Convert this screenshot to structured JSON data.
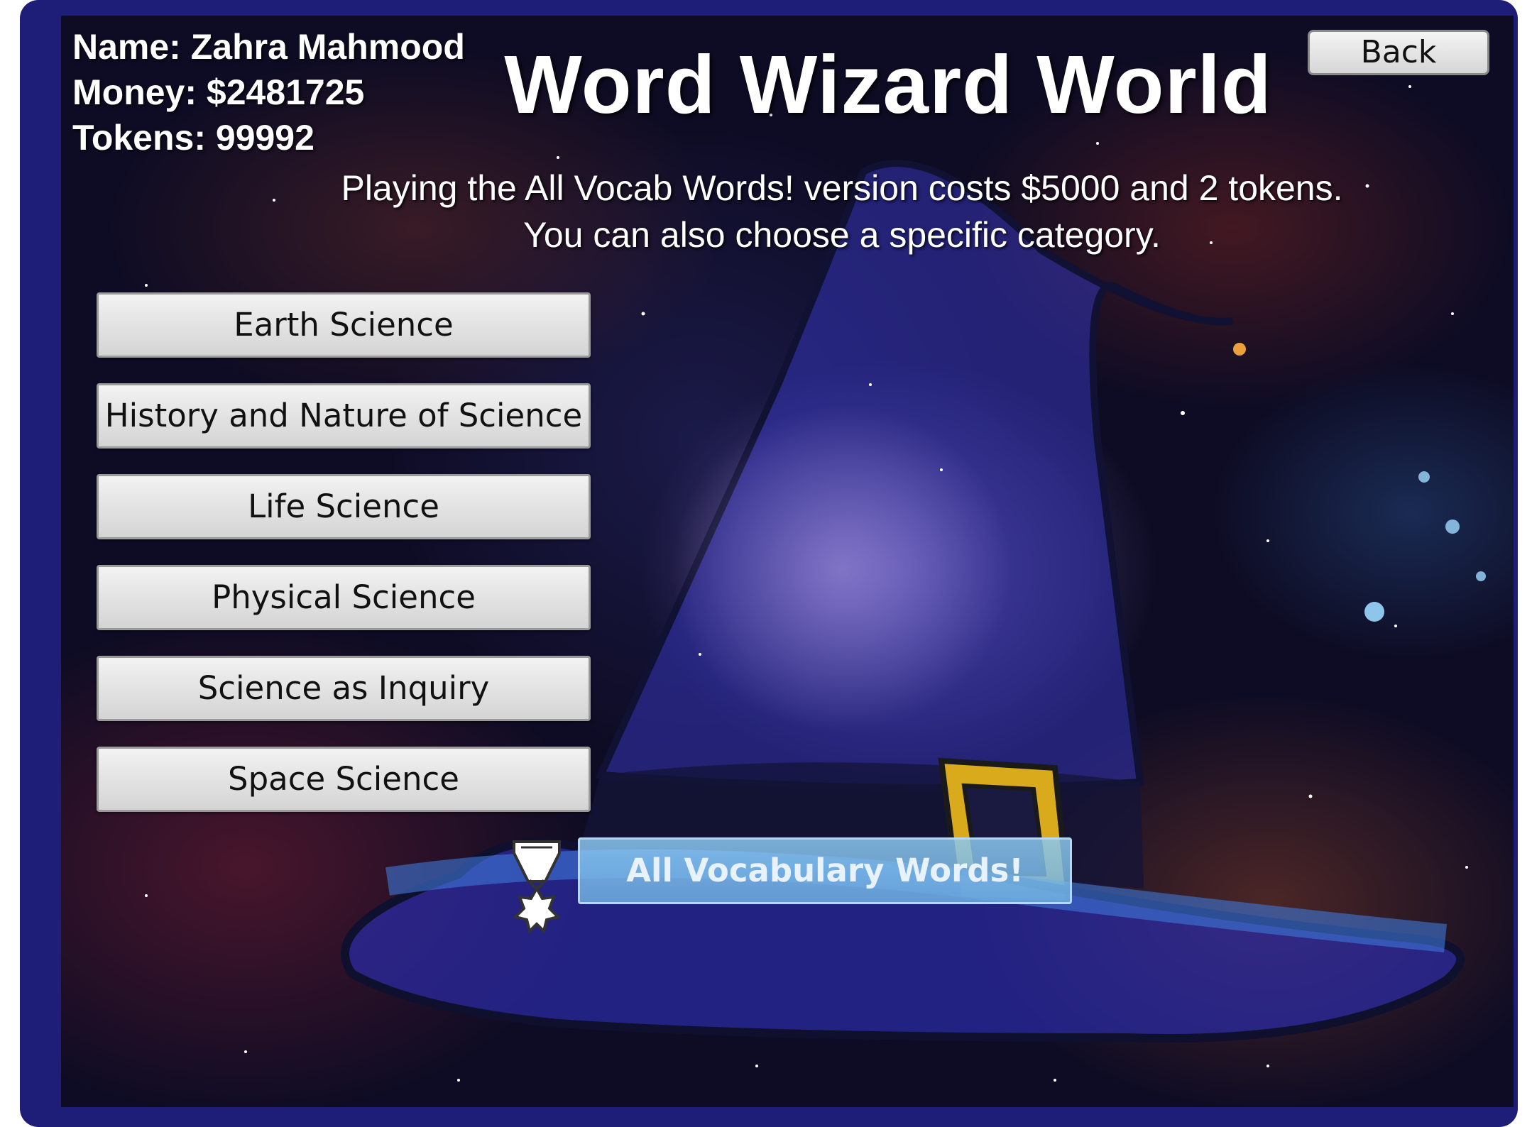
{
  "app": {
    "title": "Word Wizard World"
  },
  "player": {
    "name_line": "Name: Zahra Mahmood",
    "money_line": "Money: $2481725",
    "tokens_line": "Tokens: 99992"
  },
  "header": {
    "back_label": "Back"
  },
  "info": {
    "line1": "Playing the All Vocab Words! version costs $5000 and 2 tokens.",
    "line2": "You can also choose a specific category."
  },
  "categories": [
    {
      "label": "Earth Science"
    },
    {
      "label": "History and Nature of Science"
    },
    {
      "label": "Life Science"
    },
    {
      "label": "Physical Science"
    },
    {
      "label": "Science as Inquiry"
    },
    {
      "label": "Space Science"
    }
  ],
  "all_vocab": {
    "label": "All Vocabulary Words!"
  },
  "colors": {
    "frame": "#1e1e78",
    "hat": "#2a2a9e",
    "hat_band": "#1a1a4a",
    "buckle": "#e0b020",
    "button_face": "#e6e6e6",
    "all_vocab_button": "#86c0ea"
  },
  "icons": {
    "medal": "medal-icon"
  }
}
